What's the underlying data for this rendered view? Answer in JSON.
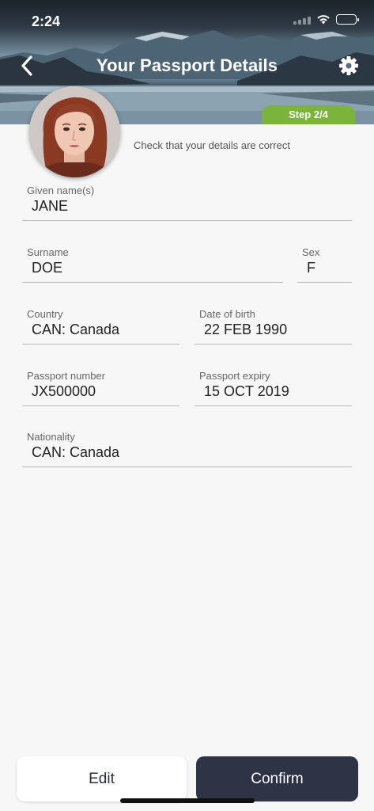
{
  "status_bar": {
    "time": "2:24"
  },
  "header": {
    "title": "Your Passport Details",
    "step_badge": "Step 2/4"
  },
  "subtitle": "Check that your details are correct",
  "fields": {
    "given_names": {
      "label": "Given name(s)",
      "value": "JANE"
    },
    "surname": {
      "label": "Surname",
      "value": "DOE"
    },
    "sex": {
      "label": "Sex",
      "value": "F"
    },
    "country": {
      "label": "Country",
      "value": "CAN: Canada"
    },
    "date_of_birth": {
      "label": "Date of birth",
      "value": "22 FEB 1990"
    },
    "passport_number": {
      "label": "Passport number",
      "value": "JX500000"
    },
    "passport_expiry": {
      "label": "Passport expiry",
      "value": "15 OCT 2019"
    },
    "nationality": {
      "label": "Nationality",
      "value": "CAN: Canada"
    }
  },
  "actions": {
    "edit_label": "Edit",
    "confirm_label": "Confirm"
  },
  "icons": {
    "back": "chevron-left-icon",
    "settings": "gear-icon",
    "wifi": "wifi-icon",
    "battery": "battery-icon"
  },
  "colors": {
    "step_badge": "#7ab43a",
    "confirm_button": "#2e3346",
    "edit_button": "#ffffff",
    "background": "#f7f7f7"
  }
}
